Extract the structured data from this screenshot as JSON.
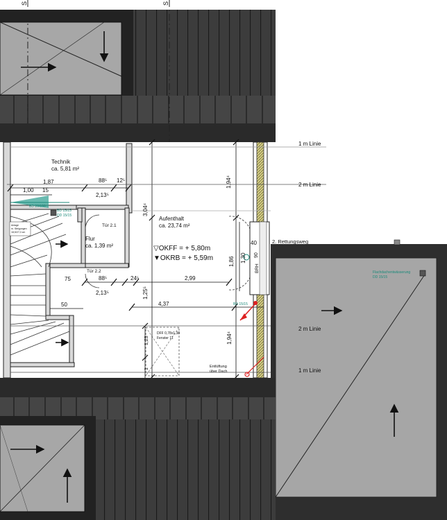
{
  "section_marks": {
    "left": "S",
    "right": "S"
  },
  "rooms": {
    "technik": {
      "name": "Technik",
      "area": "ca. 5,81 m²"
    },
    "flur": {
      "name": "Flur",
      "area": "ca. 1,39 m²"
    },
    "aufenthalt": {
      "name": "Aufenthalt",
      "area": "ca. 23,74 m²"
    }
  },
  "levels": {
    "okff": "▽OKFF = + 5,80m",
    "okrb": "▼OKRB = + 5,59m"
  },
  "lines": {
    "one_m_top": "1 m Linie",
    "two_m_top": "2 m Linie",
    "two_m_right": "2 m Linie",
    "one_m_bottom": "1 m Linie"
  },
  "labels": {
    "rettungsweg": "2. Rettungsweg",
    "flachdach": "Flachdachentwässerung",
    "flachdach_dd": "DD 15/15",
    "entlueftung_1": "Entlüftung",
    "entlueftung_2": "über Dach",
    "brh": "BRH",
    "tuer_21": "Tür 2.1",
    "tuer_22": "Tür 2.2",
    "bd_1": "BD 20/100",
    "bd_2": "BD 15/15",
    "dd_2": "DD 15/15",
    "bd_3": "BD 15/15",
    "fenster_1": "DFF 0,78x1,38",
    "fenster_2": "Fenster 11",
    "small_note_1": "Anlage",
    "small_note_2": "m. Steigungen",
    "small_note_3": "18,5/27,0 cm"
  },
  "dimensions": {
    "d187": "1,87",
    "d885a": "88⁵",
    "d125a": "12⁵",
    "d100": "1,00",
    "d15": "15",
    "d2135a": "2,13⁵",
    "d3044": "3,04⁴",
    "d1944a": "1,94⁴",
    "d40": "40",
    "d186": "1,86",
    "d130": "1,30",
    "d90": "90",
    "d75": "75",
    "d885b": "88⁵",
    "d245": "24⁵",
    "d299": "2,99",
    "d2135b": "2,13⁵",
    "d1255": "1,25⁵",
    "d437": "4,37",
    "d50": "50",
    "d123": "1,23",
    "d1944b": "1,94⁴",
    "d1": "1"
  }
}
